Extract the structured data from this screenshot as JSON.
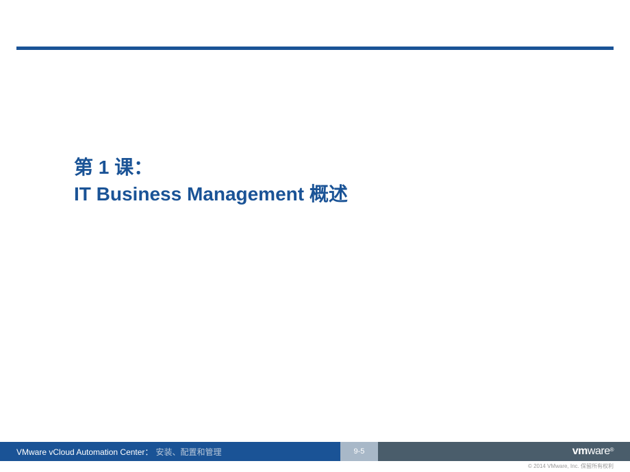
{
  "slide": {
    "title_line1": "第 1 课：",
    "title_line2": "IT Business Management 概述"
  },
  "footer": {
    "course_name": "VMware vCloud Automation Center：",
    "course_suffix": "安装、配置和管理",
    "page_number": "9-5",
    "logo_vm": "vm",
    "logo_ware": "ware",
    "logo_reg": "®"
  },
  "copyright": "© 2014 VMware, Inc. 保留所有权利"
}
